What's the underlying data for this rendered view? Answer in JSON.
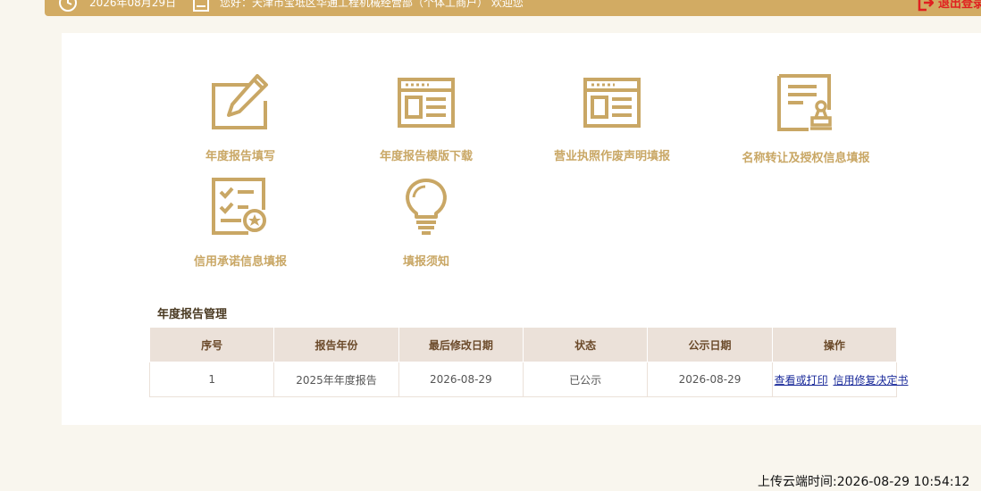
{
  "header": {
    "date": "2026年08月29日",
    "welcome": "您好：天津市宝坻区华通工程机械经营部（个体工商户）  欢迎您",
    "logout_label": "退出登录"
  },
  "tiles": [
    {
      "label": "年度报告填写",
      "icon": "edit-form-icon"
    },
    {
      "label": "年度报告模版下载",
      "icon": "template-window-icon"
    },
    {
      "label": "营业执照作废声明填报",
      "icon": "license-window-icon"
    },
    {
      "label": "名称转让及授权信息填报",
      "icon": "document-stamp-icon"
    },
    {
      "label": "信用承诺信息填报",
      "icon": "checklist-badge-icon"
    },
    {
      "label": "填报须知",
      "icon": "lightbulb-icon"
    }
  ],
  "report_section": {
    "title": "年度报告管理",
    "columns": [
      "序号",
      "报告年份",
      "最后修改日期",
      "状态",
      "公示日期",
      "操作"
    ],
    "rows": [
      {
        "index": "1",
        "year": "2025年年度报告",
        "modified": "2026-08-29",
        "status": "已公示",
        "published": "2026-08-29",
        "actions": [
          "查看或打印",
          "信用修复决定书"
        ]
      }
    ]
  },
  "footer": {
    "upload_time": "上传云端时间:2026-08-29 10:54:12"
  },
  "colors": {
    "accent": "#d2ab63",
    "tile_text": "#c9a765",
    "header_row": "#ebe1d9",
    "logout": "#e02020",
    "link": "#1a2a9a"
  }
}
